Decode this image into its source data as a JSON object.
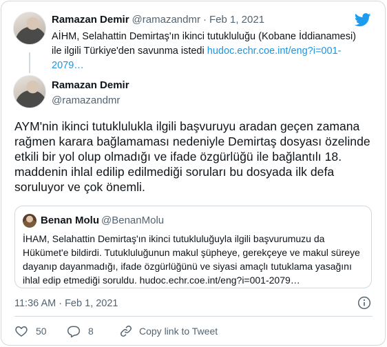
{
  "parent": {
    "name": "Ramazan Demir",
    "handle": "@ramazandmr",
    "separator": "·",
    "date": "Feb 1, 2021",
    "text": "AİHM, Selahattin Demirtaş'ın ikinci tutukluluğu (Kobane İddianamesi) ile ilgili Türkiye'den savunma istedi ",
    "link": "hudoc.echr.coe.int/eng?i=001-2079…"
  },
  "tweet": {
    "name": "Ramazan Demir",
    "handle": "@ramazandmr",
    "text": "AYM'nin ikinci tutuklulukla ilgili başvuruyu aradan geçen zamana rağmen karara bağlamaması nedeniyle Demirtaş dosyası özelinde etkili bir yol olup olmadığı ve ifade özgürlüğü ile bağlantılı 18. maddenin ihlal edilip edilmediği soruları bu dosyada ilk defa soruluyor ve çok önemli.",
    "timestamp": "11:36 AM · Feb 1, 2021"
  },
  "quote": {
    "name": "Benan Molu",
    "handle": "@BenanMolu",
    "text": "İHAM, Selahattin Demirtaş'ın ikinci tutukluluğuyla ilgili başvurumuzu da Hükümet'e bildirdi. Tutukluluğunun makul şüpheye, gerekçeye ve makul süreye dayanıp dayanmadığı, ifade özgürlüğünü ve siyasi amaçlı tutuklama yasağını ihlal edip etmediği soruldu. hudoc.echr.coe.int/eng?i=001-2079…"
  },
  "actions": {
    "likes": "50",
    "replies": "8",
    "copy_label": "Copy link to Tweet"
  },
  "icons": {
    "brand": "twitter-bird-icon",
    "like": "heart-icon",
    "reply": "reply-bubble-icon",
    "copy": "link-icon",
    "info": "info-icon"
  },
  "colors": {
    "brand": "#1d9bf0",
    "link": "#1b95e0",
    "muted": "#536471",
    "border": "#cfd9de"
  }
}
